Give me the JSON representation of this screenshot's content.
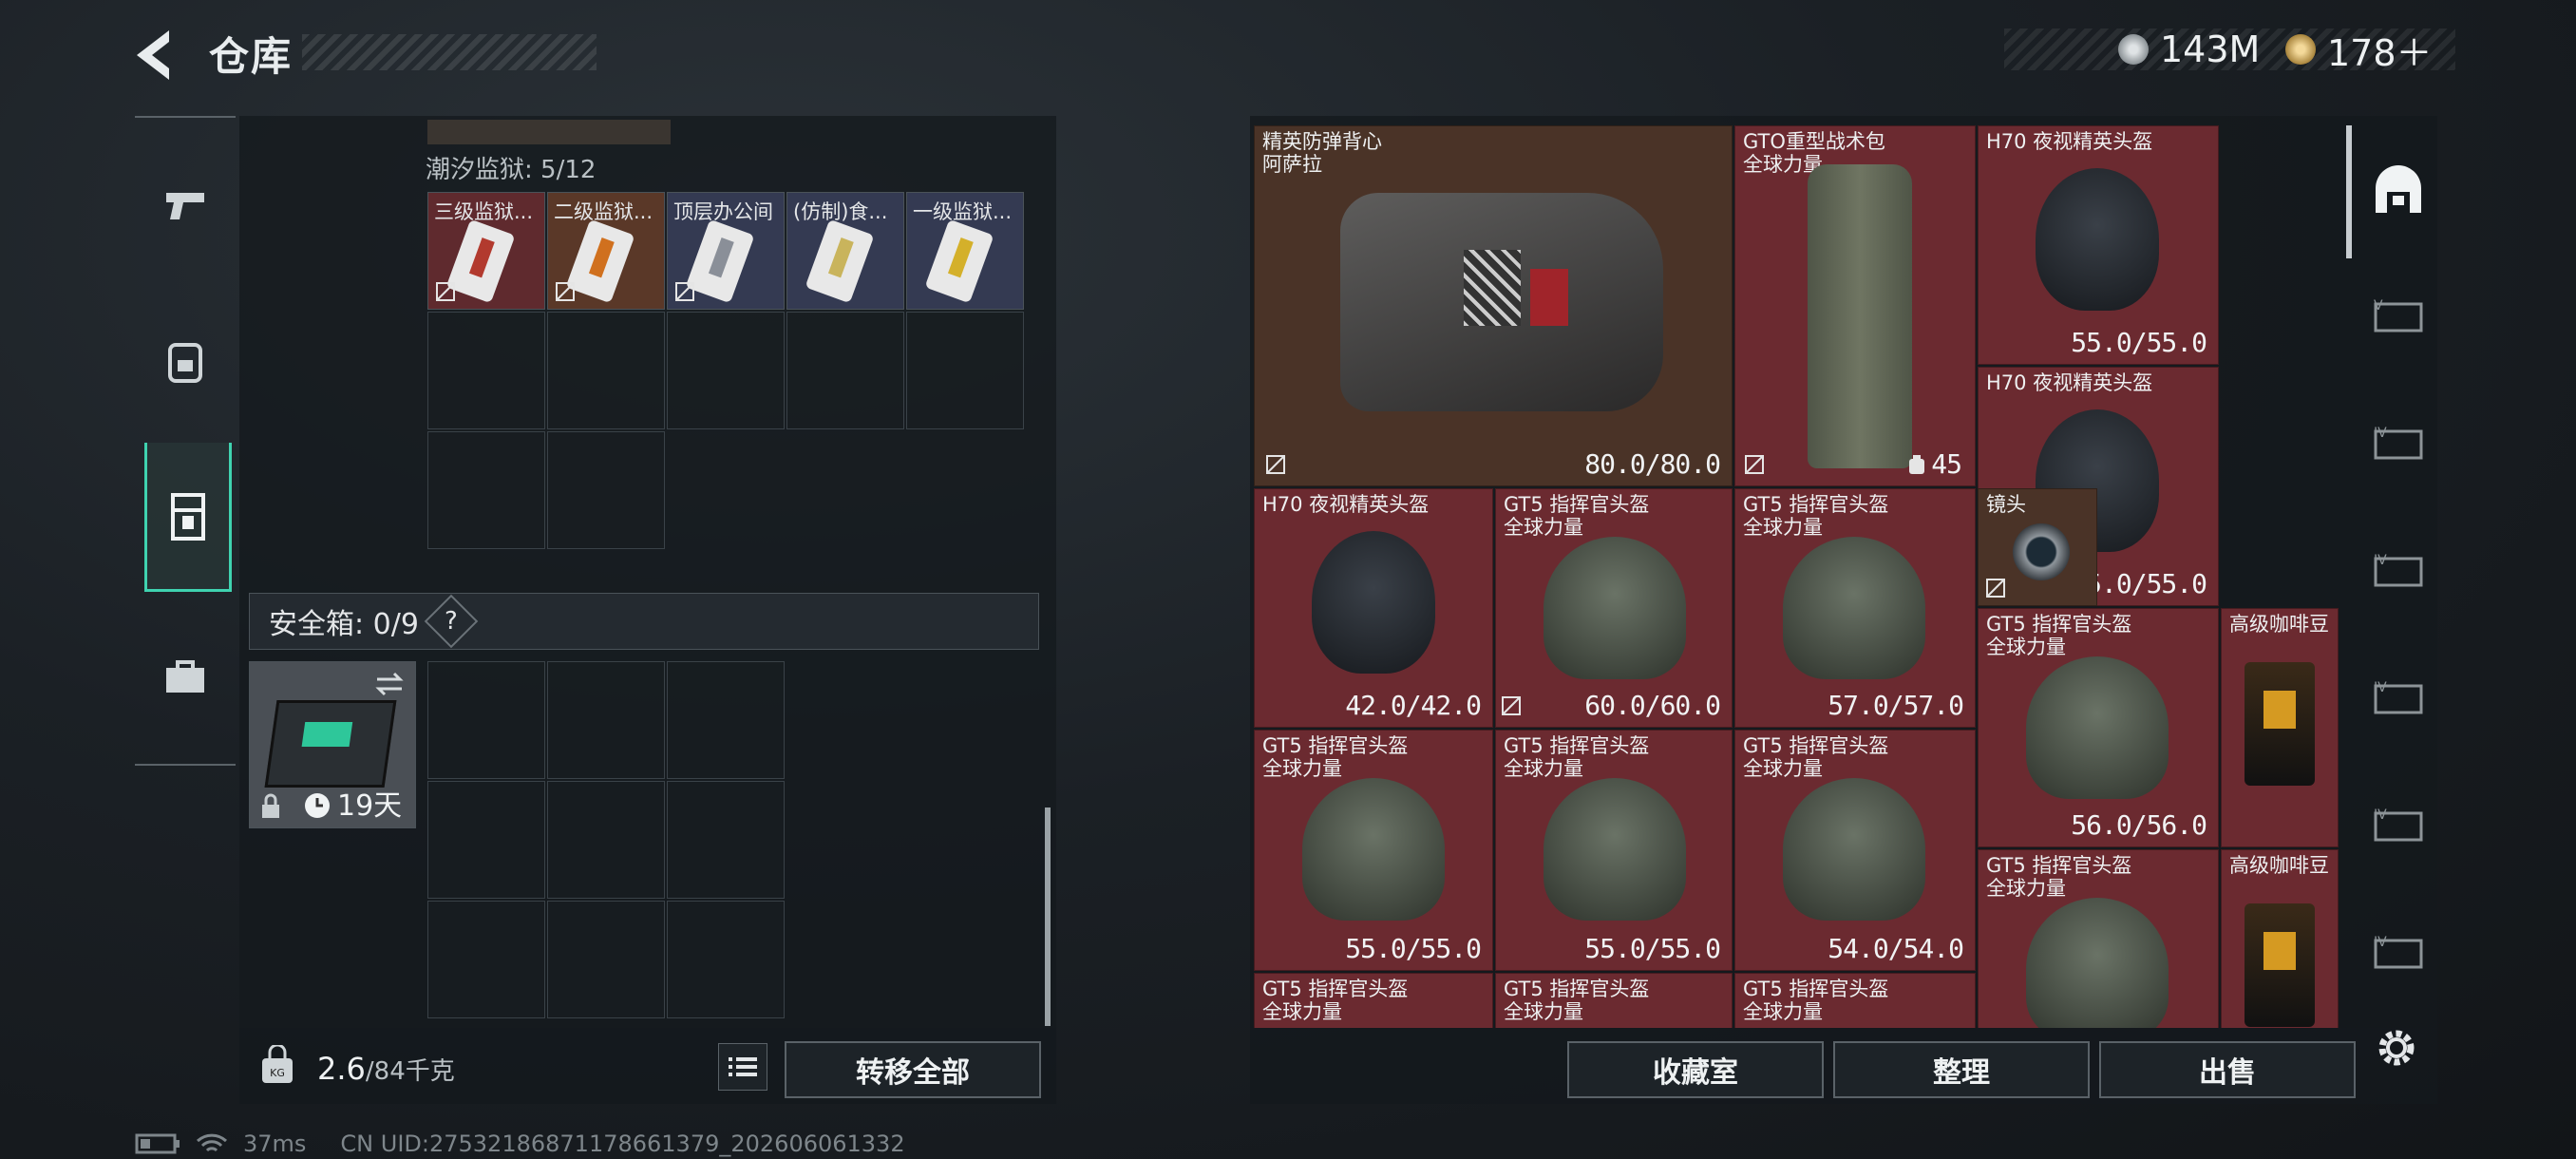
{
  "header": {
    "title": "仓库",
    "currencies": [
      {
        "icon": "silver-coin-icon",
        "value": "143M"
      },
      {
        "icon": "gold-coin-icon",
        "value": "178＋"
      }
    ]
  },
  "nav": [
    "pistol-icon",
    "backpack-icon",
    "locker-icon",
    "briefcase-icon"
  ],
  "left": {
    "prison_label": "潮汐监狱: 5/12",
    "prison_items": [
      "三级监狱...",
      "二级监狱...",
      "顶层办公间",
      "(仿制)食...",
      "一级监狱..."
    ],
    "safe_label": "安全箱: 0/9",
    "safe_help": "?",
    "safe_case_timer": "19天",
    "weight": "2.6",
    "weight_max": "/84千克",
    "transfer_all": "转移全部"
  },
  "right": {
    "vest": {
      "name": "精英防弹背心",
      "sub": "阿萨拉",
      "dur": "80.0/80.0"
    },
    "bag": {
      "name": "GTO重型战术包",
      "sub": "全球力量",
      "count": "45"
    },
    "helmets": [
      {
        "name": "H70 夜视精英头盔",
        "dur": "55.0/55.0"
      },
      {
        "name": "H70 夜视精英头盔",
        "dur": "55.0/55.0"
      },
      {
        "name": "H70 夜视精英头盔",
        "dur": "42.0/42.0"
      },
      {
        "name": "GT5 指挥官头盔",
        "sub": "全球力量",
        "dur": "60.0/60.0"
      },
      {
        "name": "GT5 指挥官头盔",
        "sub": "全球力量",
        "dur": "57.0/57.0"
      },
      {
        "name": "GT5 指挥官头盔",
        "sub": "全球力量",
        "dur": "56.0/56.0"
      },
      {
        "name": "GT5 指挥官头盔",
        "sub": "全球力量",
        "dur": "55.0/55.0"
      },
      {
        "name": "GT5 指挥官头盔",
        "sub": "全球力量",
        "dur": "55.0/55.0"
      },
      {
        "name": "GT5 指挥官头盔",
        "sub": "全球力量",
        "dur": "54.0/54.0"
      },
      {
        "name": "GT5 指挥官头盔",
        "sub": "全球力量"
      },
      {
        "name": "GT5 指挥官头盔",
        "sub": "全球力量"
      },
      {
        "name": "GT5 指挥官头盔",
        "sub": "全球力量"
      },
      {
        "name": "GT5 指挥官头盔",
        "sub": "全球力量"
      }
    ],
    "lens": "镜头",
    "coffee": "高级咖啡豆",
    "buttons": [
      "收藏室",
      "整理",
      "出售"
    ]
  },
  "status": {
    "ping": "37ms",
    "uid": "CN UID:27532186871178661379_202606061332"
  },
  "colors": {
    "accent": "#3fd3b0",
    "item_red": "#6b2a30",
    "item_brown": "#4a3327"
  }
}
